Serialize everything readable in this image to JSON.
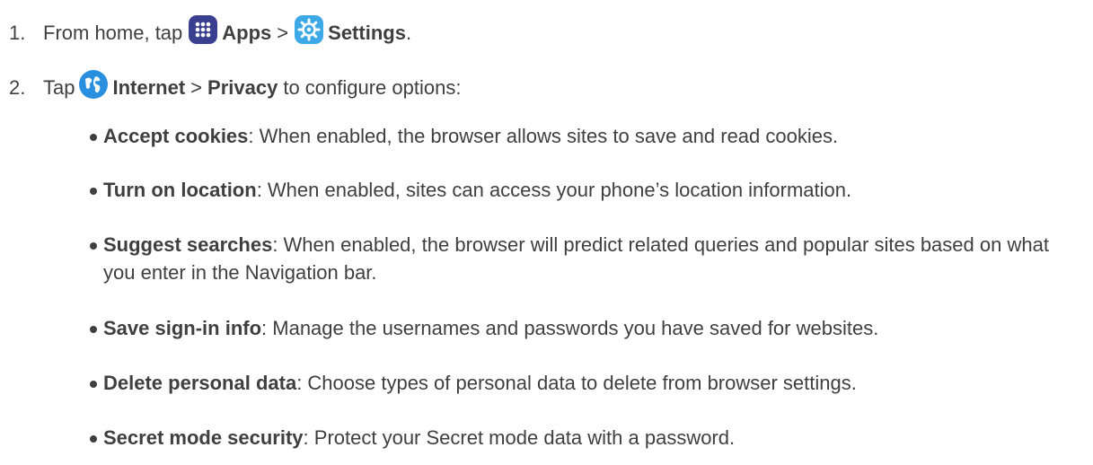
{
  "steps": [
    {
      "number": "1.",
      "prefix": "From home, tap",
      "apps_icon": "apps-grid-icon",
      "apps_label": "Apps",
      "separator": ">",
      "settings_icon": "settings-gear-icon",
      "settings_label": "Settings",
      "suffix": "."
    },
    {
      "number": "2.",
      "prefix": "Tap",
      "internet_icon": "internet-globe-icon",
      "internet_label": "Internet",
      "separator": ">",
      "privacy_label": "Privacy",
      "suffix": "to configure options:"
    }
  ],
  "options": [
    {
      "title": "Accept cookies",
      "desc": ": When enabled, the browser allows sites to save and read cookies."
    },
    {
      "title": "Turn on location",
      "desc": ": When enabled, sites can access your phone’s location information."
    },
    {
      "title": "Suggest searches",
      "desc": ": When enabled, the browser will predict related queries and popular sites based on what you enter in the Navigation bar."
    },
    {
      "title": "Save sign-in info",
      "desc": ": Manage the usernames and passwords you have saved for websites."
    },
    {
      "title": "Delete personal data",
      "desc": ": Choose types of personal data to delete from browser settings."
    },
    {
      "title": "Secret mode security",
      "desc": ": Protect your Secret mode data with a password."
    }
  ],
  "colors": {
    "text": "#3f3f3f",
    "apps_icon_bg": "#3a3f8f",
    "settings_icon_bg": "#3da9e6",
    "internet_icon_bg": "#2b8fe0"
  }
}
